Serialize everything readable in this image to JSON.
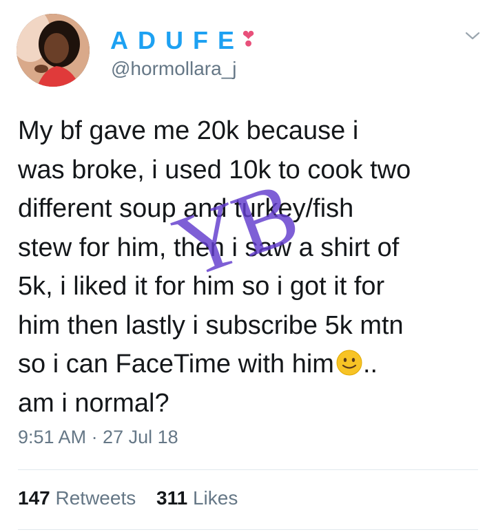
{
  "user": {
    "display_name": "ADUFE",
    "heart": "❣",
    "handle": "@hormollara_j"
  },
  "tweet": {
    "text": "My bf gave me 20k because i\nwas broke, i used 10k to cook two\ndifferent soup and turkey/fish\nstew for him, then i saw a shirt of\n5k, i liked it for him so i got it for\nhim then lastly i subscribe 5k mtn\nso i can FaceTime with him",
    "text_after_emoji": "..\nam i normal?",
    "emoji": "slightly-smiling-face",
    "timestamp": "9:51 AM · 27 Jul 18"
  },
  "watermark": "YB",
  "stats": {
    "retweets_count": "147",
    "retweets_label": "Retweets",
    "likes_count": "311",
    "likes_label": "Likes"
  },
  "colors": {
    "name": "#1da1f2",
    "secondary_text": "#657786",
    "heart": "#e8507a",
    "watermark": "#623ccd"
  }
}
